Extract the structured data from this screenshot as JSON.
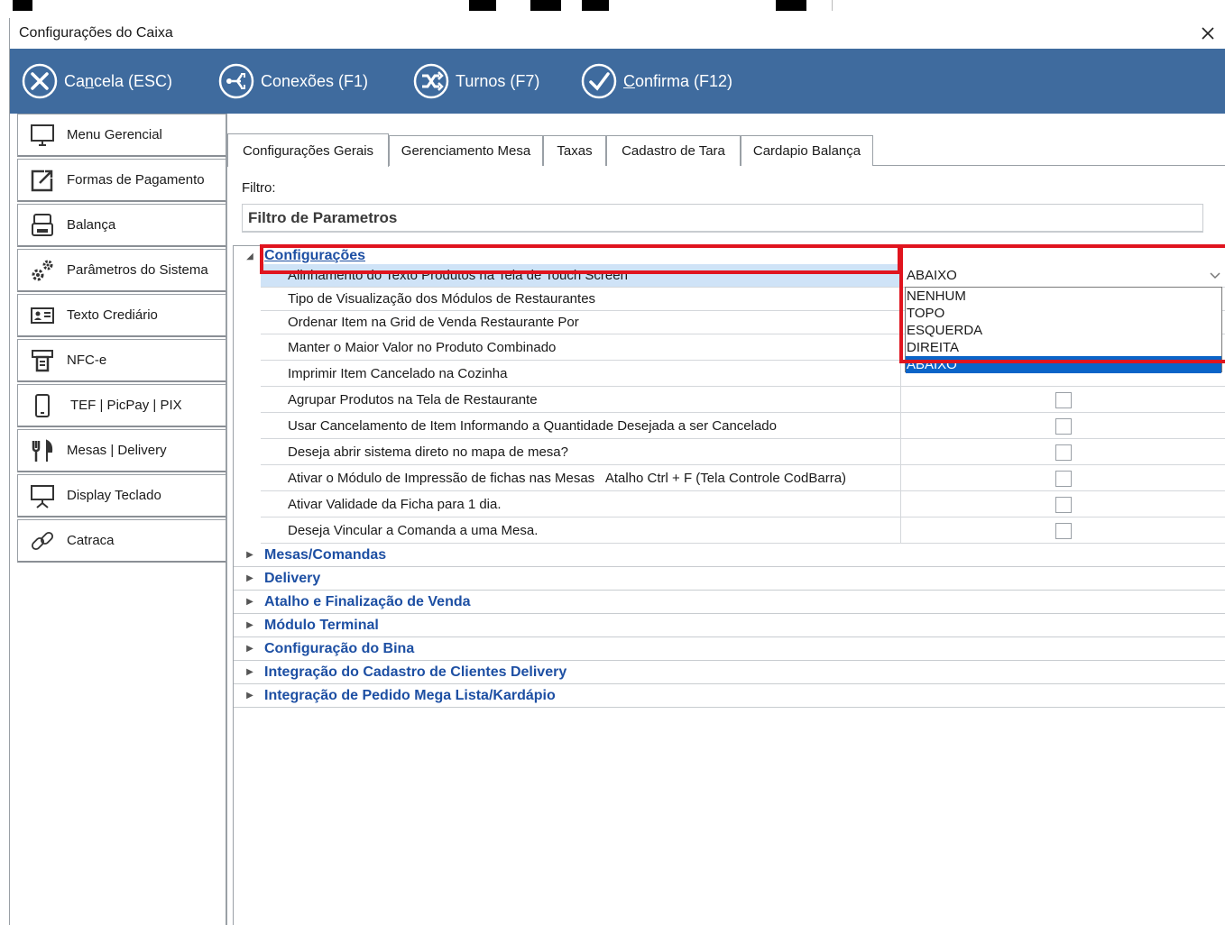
{
  "window": {
    "title": "Configurações do Caixa"
  },
  "toolbar": {
    "cancel": {
      "prefix": "Ca",
      "underline": "n",
      "suffix": "cela (ESC)"
    },
    "connections": "Conexões (F1)",
    "shifts": "Turnos (F7)",
    "confirm": {
      "prefix": "",
      "underline": "C",
      "suffix": "onfirma (F12)"
    }
  },
  "sidebar": {
    "items": [
      {
        "label": "Menu Gerencial",
        "icon": "monitor-icon"
      },
      {
        "label": "Formas de Pagamento",
        "icon": "external-link-icon"
      },
      {
        "label": "Balança",
        "icon": "scale-icon"
      },
      {
        "label": "Parâmetros do Sistema",
        "icon": "gears-icon"
      },
      {
        "label": "Texto Crediário",
        "icon": "id-card-icon"
      },
      {
        "label": "NFC-e",
        "icon": "receipt-printer-icon"
      },
      {
        "label": "TEF | PicPay | PIX",
        "icon": "smartphone-icon"
      },
      {
        "label": "Mesas | Delivery",
        "icon": "fork-knife-icon"
      },
      {
        "label": "Display Teclado",
        "icon": "display-stand-icon"
      },
      {
        "label": "Catraca",
        "icon": "chain-link-icon"
      }
    ]
  },
  "tabs": [
    {
      "label": "Configurações Gerais",
      "active": true
    },
    {
      "label": "Gerenciamento Mesa",
      "active": false
    },
    {
      "label": "Taxas",
      "active": false
    },
    {
      "label": "Cadastro de Tara",
      "active": false
    },
    {
      "label": "Cardapio Balança",
      "active": false
    }
  ],
  "filter": {
    "label": "Filtro:",
    "placeholder": "Filtro de Parametros"
  },
  "grid": {
    "expanded_category": "Configurações",
    "properties": [
      {
        "name": "Alinhamento do Texto Produtos na Tela de Touch Screen",
        "value": "ABAIXO"
      },
      {
        "name": "Tipo de Visualização dos Módulos de Restaurantes"
      },
      {
        "name": "Ordenar Item na Grid de Venda Restaurante Por"
      },
      {
        "name": "Manter o Maior Valor no Produto Combinado"
      },
      {
        "name": "Imprimir Item Cancelado na Cozinha"
      },
      {
        "name": "Agrupar Produtos na Tela de Restaurante",
        "checked": false
      },
      {
        "name": "Usar Cancelamento de Item Informando a Quantidade Desejada a ser Cancelado",
        "checked": false
      },
      {
        "name": "Deseja abrir sistema direto no mapa de mesa?",
        "checked": false
      },
      {
        "name": "Ativar o Módulo de Impressão de fichas nas Mesas   Atalho Ctrl + F (Tela Controle CodBarra)",
        "checked": false
      },
      {
        "name": "Ativar Validade da Ficha para 1 dia.",
        "checked": false
      },
      {
        "name": "Deseja Vincular a Comanda a uma Mesa.",
        "checked": false
      }
    ],
    "collapsed_categories": [
      "Mesas/Comandas",
      "Delivery",
      "Atalho e Finalização de Venda",
      "Módulo Terminal",
      "Configuração do Bina",
      "Integração do Cadastro de Clientes Delivery",
      "Integração de Pedido Mega Lista/Kardápio"
    ]
  },
  "dropdown": {
    "selected": "ABAIXO",
    "options": [
      "NENHUM",
      "TOPO",
      "ESQUERDA",
      "DIREITA",
      "ABAIXO"
    ]
  },
  "colors": {
    "toolbar": "#3f6b9e",
    "category_text": "#1d4fa3",
    "highlight": "#e0141e",
    "selection": "#0a64c8"
  }
}
